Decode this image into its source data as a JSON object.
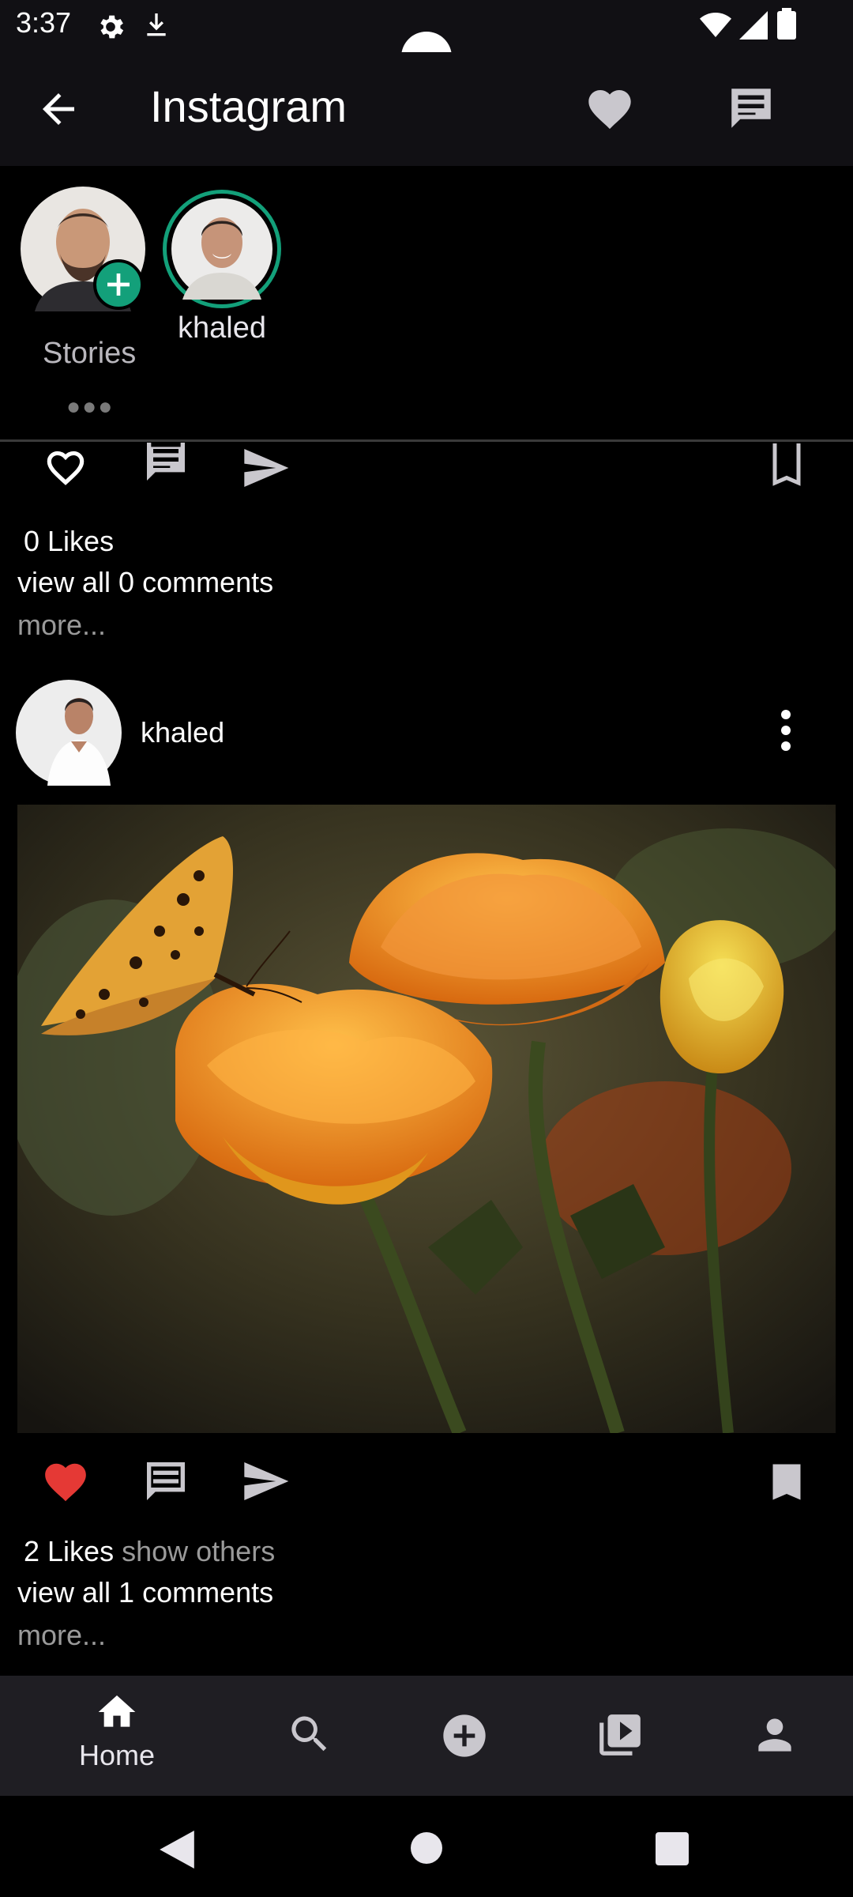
{
  "status": {
    "time": "3:37"
  },
  "appbar": {
    "title": "Instagram"
  },
  "stories": {
    "own_label": "Stories",
    "items": [
      {
        "name": "khaled"
      }
    ]
  },
  "posts": [
    {
      "likes_text": "0 Likes",
      "comments_text": "view all 0 comments",
      "more_text": "more..."
    },
    {
      "username": "khaled",
      "liked": true,
      "likes_text": "2 Likes",
      "show_others_text": "show others",
      "comments_text": "view all 1 comments",
      "more_text": "more..."
    }
  ],
  "bottom_nav": {
    "home_label": "Home",
    "items": [
      "home-icon",
      "search-icon",
      "add-circle-icon",
      "video-library-icon",
      "person-icon"
    ]
  },
  "colors": {
    "accent_green": "#13a07a",
    "like_red": "#e53935",
    "icon_gray": "#c9c7cd"
  }
}
